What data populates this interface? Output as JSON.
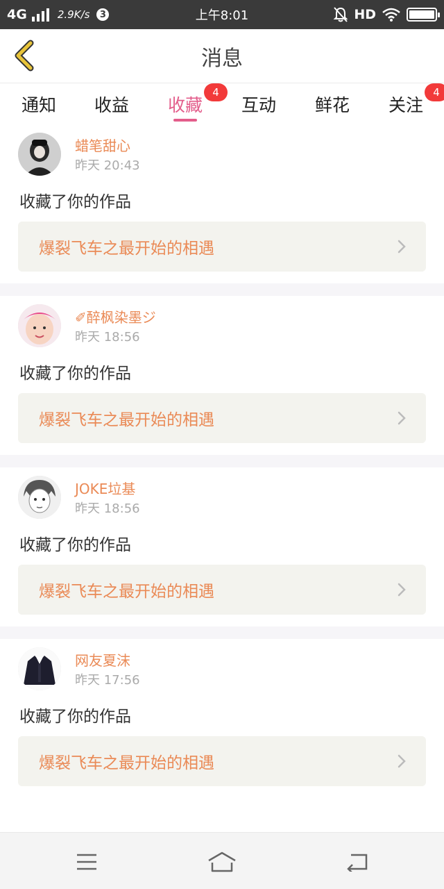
{
  "status_bar": {
    "network": "4G",
    "speed": "2.9K/s",
    "notification_count": "3",
    "time": "上午8:01",
    "hd": "HD"
  },
  "header": {
    "title": "消息"
  },
  "tabs": [
    {
      "label": "通知",
      "badge": ""
    },
    {
      "label": "收益",
      "badge": ""
    },
    {
      "label": "收藏",
      "badge": "4",
      "active": true
    },
    {
      "label": "互动",
      "badge": ""
    },
    {
      "label": "鲜花",
      "badge": ""
    },
    {
      "label": "关注",
      "badge": "4"
    }
  ],
  "messages": [
    {
      "user": "蜡笔甜心",
      "time": "昨天 20:43",
      "action": "收藏了你的作品",
      "work": "爆裂飞车之最开始的相遇"
    },
    {
      "user": "✐醉枫染墨ジ",
      "time": "昨天 18:56",
      "action": "收藏了你的作品",
      "work": "爆裂飞车之最开始的相遇"
    },
    {
      "user": "JOKE垃基",
      "time": "昨天 18:56",
      "action": "收藏了你的作品",
      "work": "爆裂飞车之最开始的相遇"
    },
    {
      "user": "网友夏沫",
      "time": "昨天 17:56",
      "action": "收藏了你的作品",
      "work": "爆裂飞车之最开始的相遇"
    }
  ],
  "colors": {
    "accent": "#e35d8b",
    "username": "#ea8a56",
    "badge": "#f23a3a",
    "back_arrow": "#e8c43a"
  }
}
